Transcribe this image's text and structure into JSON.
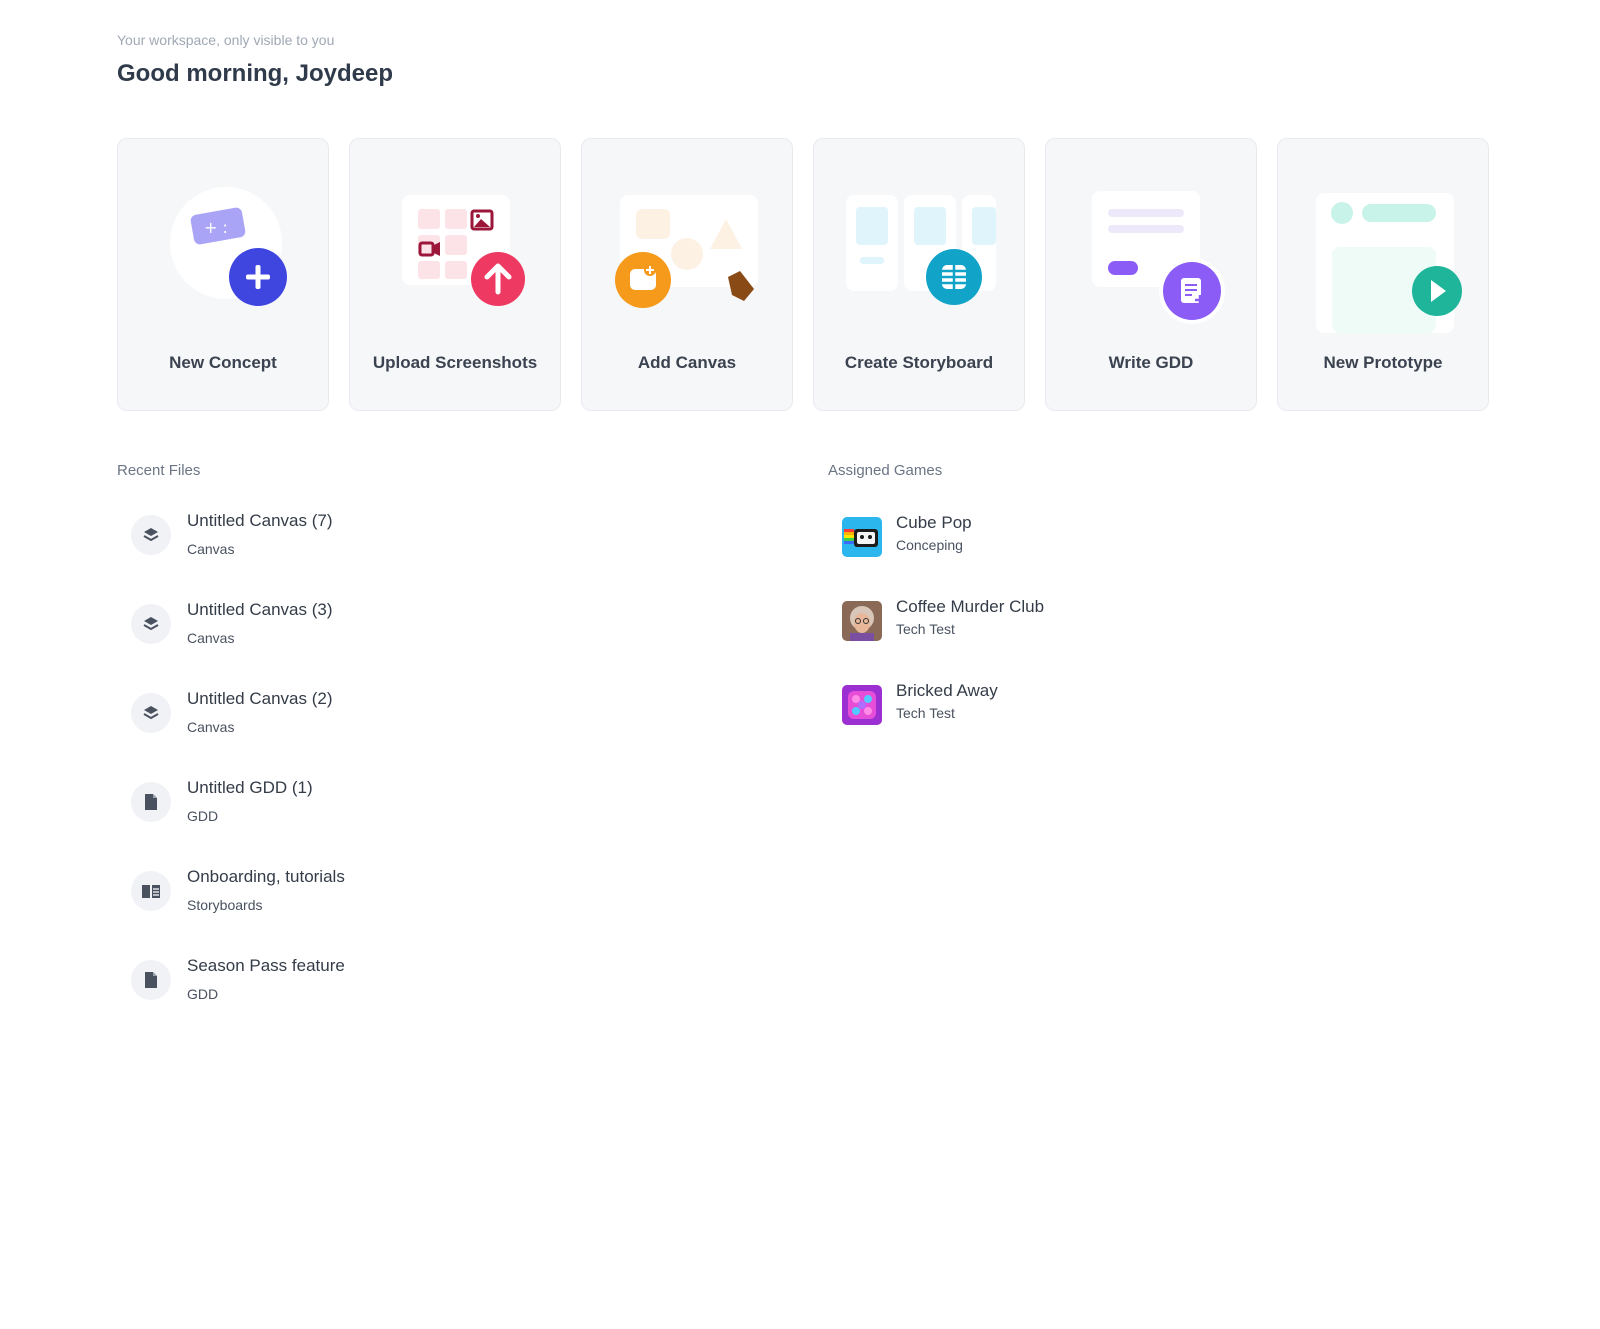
{
  "header": {
    "subtitle": "Your workspace, only visible to you",
    "greeting": "Good morning, Joydeep"
  },
  "actions": [
    {
      "label": "New Concept",
      "icon": "plus-icon",
      "accent": "#3f46e0"
    },
    {
      "label": "Upload Screenshots",
      "icon": "arrow-up-icon",
      "accent": "#ee3a62"
    },
    {
      "label": "Add Canvas",
      "icon": "image-add-icon",
      "accent": "#f59a1b"
    },
    {
      "label": "Create Storyboard",
      "icon": "grid-icon",
      "accent": "#12a3c9"
    },
    {
      "label": "Write GDD",
      "icon": "document-edit-icon",
      "accent": "#8b5cf6"
    },
    {
      "label": "New Prototype",
      "icon": "play-icon",
      "accent": "#1fb59a"
    }
  ],
  "recent_files": {
    "title": "Recent Files",
    "items": [
      {
        "name": "Untitled Canvas (7)",
        "type": "Canvas",
        "icon": "layers-icon"
      },
      {
        "name": "Untitled Canvas (3)",
        "type": "Canvas",
        "icon": "layers-icon"
      },
      {
        "name": "Untitled Canvas (2)",
        "type": "Canvas",
        "icon": "layers-icon"
      },
      {
        "name": "Untitled GDD (1)",
        "type": "GDD",
        "icon": "document-icon"
      },
      {
        "name": "Onboarding, tutorials",
        "type": "Storyboards",
        "icon": "book-icon"
      },
      {
        "name": "Season Pass feature",
        "type": "GDD",
        "icon": "document-icon"
      }
    ]
  },
  "assigned_games": {
    "title": "Assigned Games",
    "items": [
      {
        "name": "Cube Pop",
        "status": "Conceping",
        "thumb": "cube-pop-thumbnail"
      },
      {
        "name": "Coffee Murder Club",
        "status": "Tech Test",
        "thumb": "coffee-murder-club-thumbnail"
      },
      {
        "name": "Bricked Away",
        "status": "Tech Test",
        "thumb": "bricked-away-thumbnail"
      }
    ]
  }
}
